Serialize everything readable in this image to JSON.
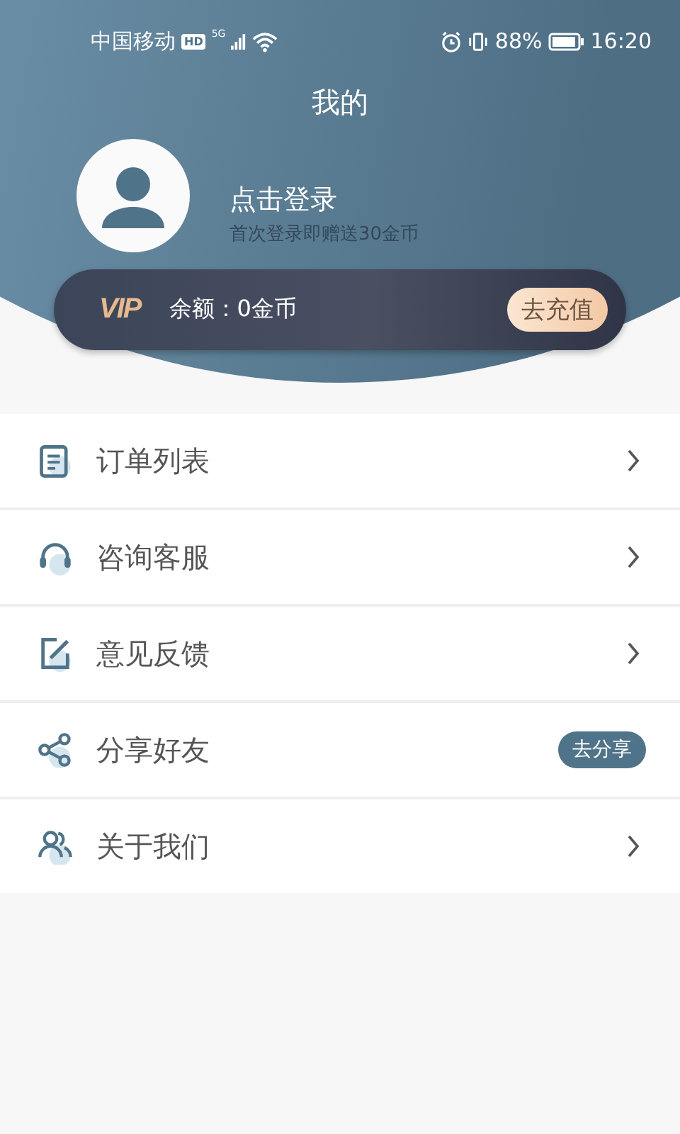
{
  "status_bar": {
    "carrier": "中国移动",
    "hd": "HD",
    "network": "5G",
    "battery_text": "88%",
    "time": "16:20"
  },
  "header": {
    "title": "我的"
  },
  "profile": {
    "login": "点击登录",
    "hint": "首次登录即赠送30金币"
  },
  "vip": {
    "badge": "VIP",
    "balance": "余额：0金币",
    "button": "去充值"
  },
  "menu": [
    {
      "label": "订单列表",
      "kind": "link"
    },
    {
      "label": "咨询客服",
      "kind": "link"
    },
    {
      "label": "意见反馈",
      "kind": "link"
    },
    {
      "label": "分享好友",
      "kind": "action",
      "action": "去分享"
    },
    {
      "label": "关于我们",
      "kind": "link"
    }
  ]
}
